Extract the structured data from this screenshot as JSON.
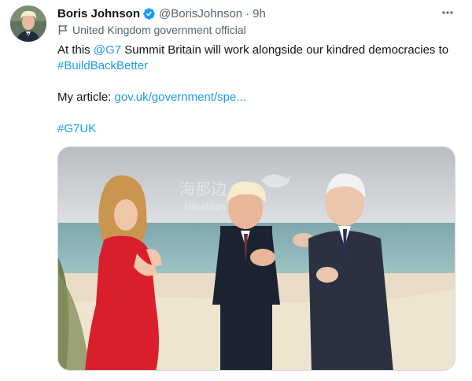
{
  "author": {
    "name": "Boris Johnson",
    "handle": "@BorisJohnson",
    "separator": "·",
    "time": "9h",
    "label": "United Kingdom government official"
  },
  "tweet": {
    "line1_prefix": "At this ",
    "mention": "@G7",
    "line1_suffix": " Summit Britain will work alongside our kindred democracies to",
    "hashtag1": "#BuildBackBetter",
    "article_prefix": "My article: ",
    "article_link": "gov.uk/government/spe...",
    "hashtag2": "#G7UK"
  },
  "media": {
    "watermark_cn": "海那边",
    "watermark_en": "Hinabian"
  },
  "icons": {
    "verified": "verified-badge-icon",
    "flag": "flag-icon",
    "more": "more-options-icon"
  },
  "colors": {
    "link": "#1d9bf0",
    "secondary_text": "#536471"
  }
}
